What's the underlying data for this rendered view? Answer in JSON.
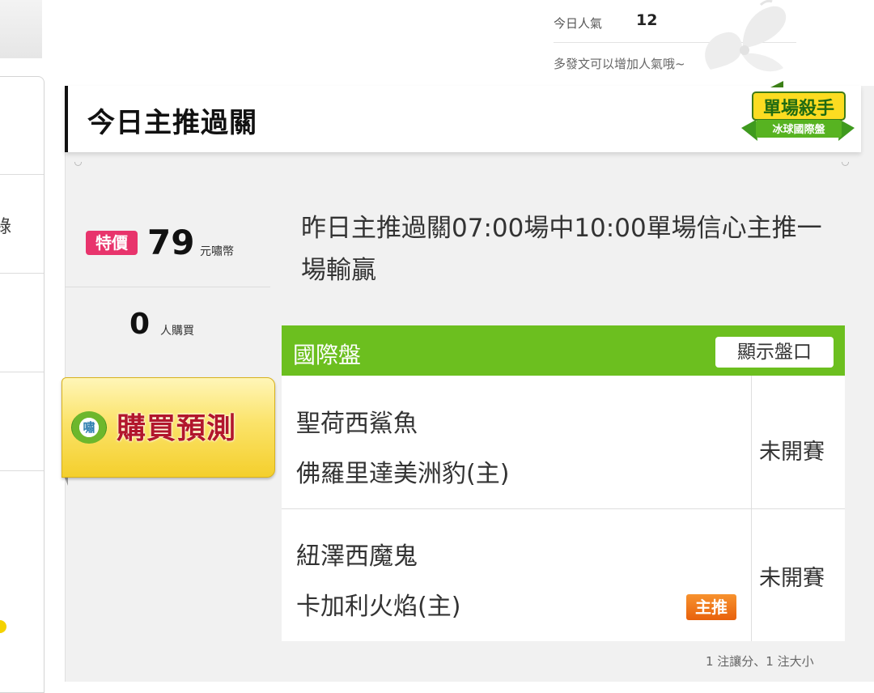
{
  "header": {
    "popularity_label": "今日人氣",
    "popularity_value": "12",
    "popularity_note": "多發文可以增加人氣哦~"
  },
  "sidebar": {
    "partial_char": "綠"
  },
  "panel": {
    "title": "今日主推過關",
    "badge": {
      "title": "單場殺手",
      "subtitle": "冰球國際盤"
    }
  },
  "pricing": {
    "special_tag": "特價",
    "price": "79",
    "currency": "元嘯幣",
    "buyers": "0",
    "buyers_unit": "人購買",
    "buy_icon_char": "嘯",
    "buy_button": "購買預測"
  },
  "headline": "昨日主推過關07:00場中10:00單場信心主推一場輸贏",
  "table": {
    "title": "國際盤",
    "show_odds_button": "顯示盤口",
    "matches": [
      {
        "away": "聖荷西鯊魚",
        "home": "佛羅里達美洲豹(主)",
        "status": "未開賽",
        "tag": ""
      },
      {
        "away": "紐澤西魔鬼",
        "home": "卡加利火焰(主)",
        "status": "未開賽",
        "tag": "主推"
      }
    ],
    "footnote": "1 注讓分、1 注大小"
  },
  "colors": {
    "accent_green": "#6cbf1f",
    "special_pink": "#e8346c",
    "main_orange": "#ee7718",
    "buy_text_red": "#b2162c"
  }
}
